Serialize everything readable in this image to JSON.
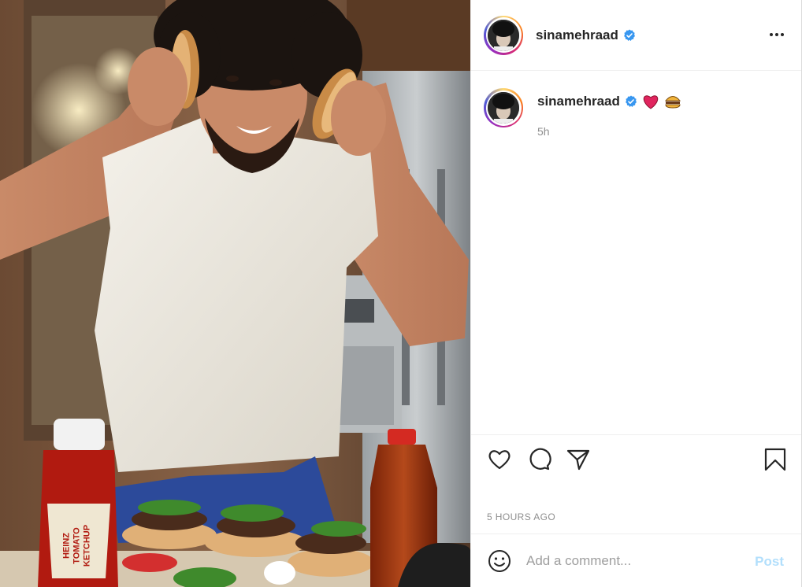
{
  "post": {
    "username": "sinamehraad",
    "verified": true,
    "caption_emojis": [
      "heart",
      "hamburger"
    ],
    "relative_time": "5h",
    "posted_ago": "5 HOURS AGO"
  },
  "photo": {
    "ketchup_label_brand": "HEINZ",
    "ketchup_label_line1": "TOMATO",
    "ketchup_label_line2": "KETCHUP"
  },
  "icons": {
    "more": "more-options-icon",
    "like": "heart-icon",
    "comment": "comment-icon",
    "share": "share-icon",
    "save": "bookmark-icon",
    "emoji": "smiley-icon"
  },
  "comment_box": {
    "placeholder": "Add a comment...",
    "post_label": "Post"
  },
  "colors": {
    "verified": "#3897f0",
    "heart": "#e0245e",
    "post_disabled": "#b2dffc",
    "muted": "#8e8e8e"
  }
}
